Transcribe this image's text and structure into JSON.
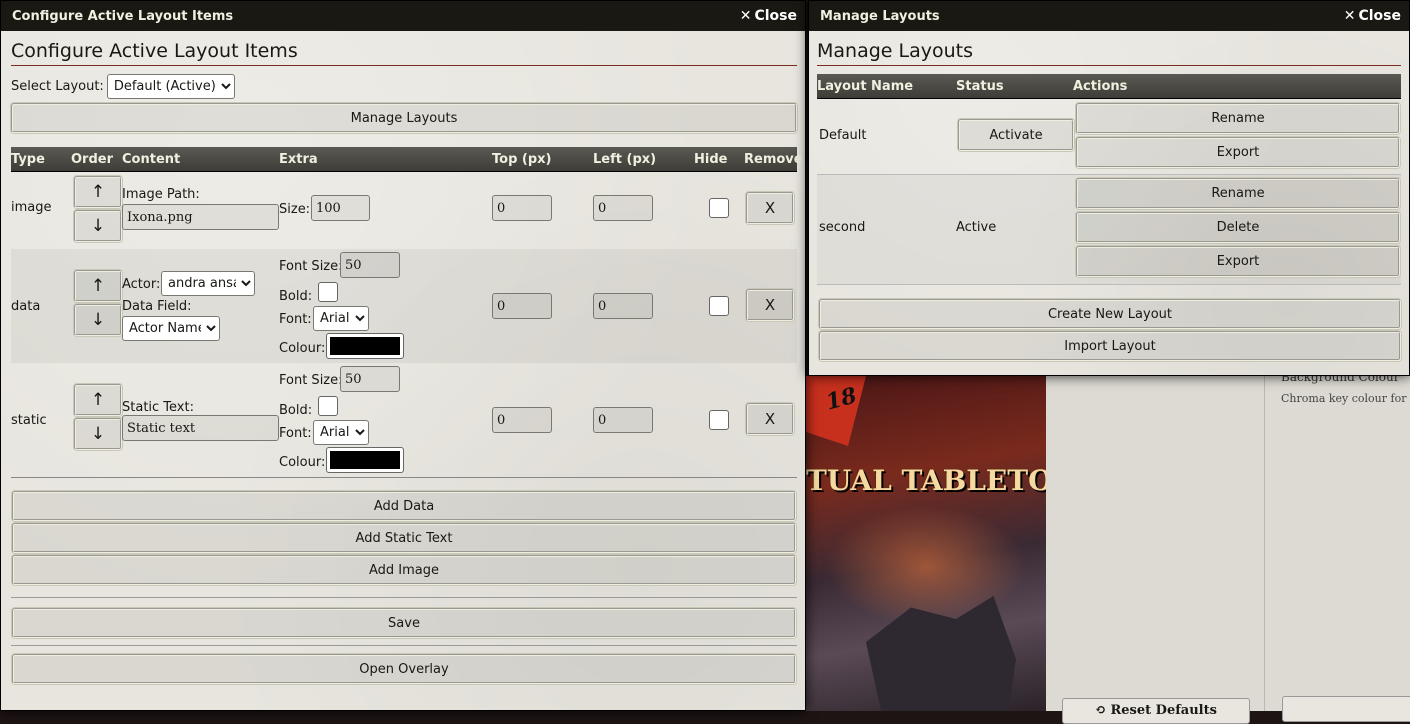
{
  "background": {
    "tagline": "TUAL TABLETOP",
    "logo_number": "18",
    "panel_label": "Background Colour",
    "panel_hint": "Chroma key colour for the",
    "reset_defaults_label": "Reset Defaults"
  },
  "configure": {
    "header_title": "Configure Active Layout Items",
    "close_label": "Close",
    "title": "Configure Active Layout Items",
    "select_layout_label": "Select Layout:",
    "select_layout_value": "Default (Active)",
    "manage_layouts_label": "Manage Layouts",
    "columns": {
      "type": "Type",
      "order": "Order",
      "content": "Content",
      "extra": "Extra",
      "top": "Top (px)",
      "left": "Left (px)",
      "hide": "Hide",
      "remove": "Remove"
    },
    "up_arrow": "↑",
    "down_arrow": "↓",
    "remove_label": "X",
    "items": [
      {
        "type": "image",
        "content_label": "Image Path:",
        "content_value": "Ixona.png",
        "size_label": "Size:",
        "size_value": "100",
        "top": "0",
        "left": "0"
      },
      {
        "type": "data",
        "actor_label": "Actor:",
        "actor_value": "andra ansa",
        "field_label": "Data Field:",
        "field_value": "Actor Name",
        "font_size_label": "Font Size:",
        "font_size_value": "50",
        "bold_label": "Bold:",
        "font_label": "Font:",
        "font_value": "Arial",
        "colour_label": "Colour:",
        "colour_value": "#000000",
        "top": "0",
        "left": "0"
      },
      {
        "type": "static",
        "content_label": "Static Text:",
        "content_value": "Static text",
        "font_size_label": "Font Size:",
        "font_size_value": "50",
        "bold_label": "Bold:",
        "font_label": "Font:",
        "font_value": "Arial",
        "colour_label": "Colour:",
        "colour_value": "#000000",
        "top": "0",
        "left": "0"
      }
    ],
    "add_data_label": "Add Data",
    "add_static_label": "Add Static Text",
    "add_image_label": "Add Image",
    "save_label": "Save",
    "open_overlay_label": "Open Overlay"
  },
  "manage": {
    "header_title": "Manage Layouts",
    "close_label": "Close",
    "title": "Manage Layouts",
    "columns": {
      "name": "Layout Name",
      "status": "Status",
      "actions": "Actions"
    },
    "layouts": [
      {
        "name": "Default",
        "status_button": "Activate",
        "actions": [
          "Rename",
          "Export"
        ]
      },
      {
        "name": "second",
        "status_text": "Active",
        "actions": [
          "Rename",
          "Delete",
          "Export"
        ]
      }
    ],
    "create_label": "Create New Layout",
    "import_label": "Import Layout"
  }
}
